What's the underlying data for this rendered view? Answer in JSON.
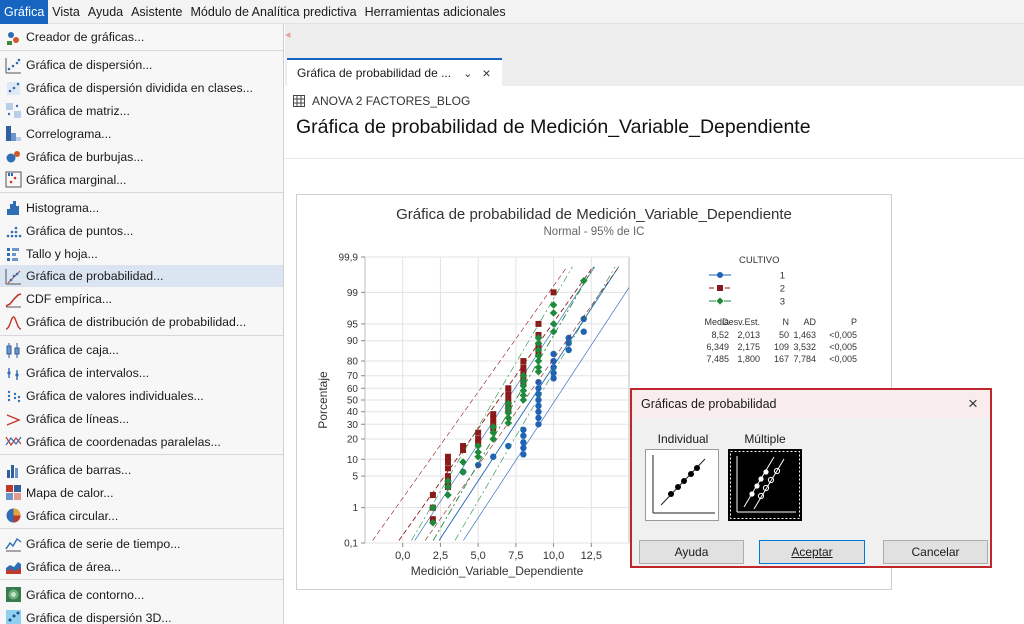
{
  "menubar": {
    "items": [
      "Gráfica",
      "Vista",
      "Ayuda",
      "Asistente",
      "Módulo de Analítica predictiva",
      "Herramientas adicionales"
    ]
  },
  "menu": {
    "groups": [
      [
        "Creador de gráficas..."
      ],
      [
        "Gráfica de dispersión...",
        "Gráfica de dispersión dividida en clases...",
        "Gráfica de matriz...",
        "Correlograma...",
        "Gráfica de burbujas...",
        "Gráfica marginal..."
      ],
      [
        "Histograma...",
        "Gráfica de puntos...",
        "Tallo y hoja...",
        "Gráfica de probabilidad...",
        "CDF empírica...",
        "Gráfica de distribución de probabilidad..."
      ],
      [
        "Gráfica de caja...",
        "Gráfica de intervalos...",
        "Gráfica de valores individuales...",
        "Gráfica de líneas...",
        "Gráfica de coordenadas paralelas..."
      ],
      [
        "Gráfica de barras...",
        "Mapa de calor...",
        "Gráfica circular..."
      ],
      [
        "Gráfica de serie de tiempo...",
        "Gráfica de área..."
      ],
      [
        "Gráfica de contorno...",
        "Gráfica de dispersión 3D..."
      ]
    ],
    "highlighted": "Gráfica de probabilidad...",
    "icons": [
      "chart-builder-icon",
      "scatterplot-icon",
      "binned-scatterplot-icon",
      "matrix-plot-icon",
      "correlogram-icon",
      "bubble-plot-icon",
      "marginal-plot-icon",
      "histogram-icon",
      "dotplot-icon",
      "stem-and-leaf-icon",
      "probability-plot-icon",
      "empirical-cdf-icon",
      "distribution-plot-icon",
      "boxplot-icon",
      "interval-plot-icon",
      "individual-value-plot-icon",
      "line-plot-icon",
      "parallel-coordinates-icon",
      "bar-chart-icon",
      "heatmap-icon",
      "pie-chart-icon",
      "time-series-icon",
      "area-graph-icon",
      "contour-plot-icon",
      "3d-scatterplot-icon"
    ]
  },
  "tab": {
    "label": "Gráfica de probabilidad de ...",
    "chevron": "⌄",
    "close": "×"
  },
  "worksheet": {
    "name": "ANOVA 2 FACTORES_BLOG",
    "icon": "table-grid-icon"
  },
  "page_title": "Gráfica de probabilidad de Medición_Variable_Dependiente",
  "chart_data": {
    "type": "scatter",
    "title": "Gráfica de probabilidad de Medición_Variable_Dependiente",
    "subtitle": "Normal - 95% de IC",
    "xlabel": "Medición_Variable_Dependiente",
    "ylabel": "Porcentaje",
    "xlim": [
      -2.5,
      15
    ],
    "x_ticks": [
      "0,0",
      "2,5",
      "5,0",
      "7,5",
      "10,0",
      "12,5"
    ],
    "x_tick_values": [
      0,
      2.5,
      5,
      7.5,
      10,
      12.5
    ],
    "y_scale": "normal-probability",
    "y_ticks": [
      "0,1",
      "1",
      "5",
      "10",
      "20",
      "30",
      "40",
      "50",
      "60",
      "70",
      "80",
      "90",
      "95",
      "99",
      "99,9"
    ],
    "y_tick_values": [
      0.1,
      1,
      5,
      10,
      20,
      30,
      40,
      50,
      60,
      70,
      80,
      90,
      95,
      99,
      99.9
    ],
    "grid": true,
    "legend_title": "CULTIVO",
    "legend_position": "right",
    "series": [
      {
        "name": "1",
        "color": "#1f63b5",
        "marker": "circle",
        "line": "solid",
        "fit_mean": 8.52,
        "fit_sd": 2.013,
        "x": [
          8,
          8,
          8,
          8,
          8,
          9,
          9,
          9,
          9,
          9,
          9,
          9,
          9,
          10,
          10,
          10,
          10,
          10,
          11,
          11,
          11,
          12,
          12,
          4,
          5,
          6,
          7
        ],
        "y": [
          12,
          15,
          18,
          22,
          26,
          30,
          35,
          40,
          45,
          50,
          55,
          60,
          65,
          68,
          72,
          76,
          80,
          84,
          86,
          89,
          91,
          93,
          96,
          6,
          8,
          11,
          16
        ]
      },
      {
        "name": "2",
        "color": "#8b1a1a",
        "marker": "square",
        "line": "dash",
        "fit_mean": 6.349,
        "fit_sd": 2.175,
        "x": [
          2,
          2,
          2,
          3,
          3,
          3,
          3,
          3,
          3,
          4,
          4,
          5,
          5,
          5,
          6,
          6,
          6,
          6,
          7,
          7,
          7,
          7,
          7,
          8,
          8,
          8,
          8,
          8,
          9,
          9,
          9,
          9,
          10
        ],
        "y": [
          0.5,
          1,
          2,
          3,
          4,
          5,
          7,
          9,
          11,
          14,
          16,
          18,
          20,
          24,
          27,
          30,
          34,
          38,
          42,
          46,
          50,
          55,
          60,
          64,
          68,
          72,
          76,
          80,
          84,
          88,
          92,
          95,
          99
        ]
      },
      {
        "name": "3",
        "color": "#1e8a3c",
        "marker": "diamond",
        "line": "dashdot",
        "fit_mean": 7.485,
        "fit_sd": 1.8,
        "x": [
          2,
          2,
          3,
          3,
          3,
          4,
          4,
          5,
          5,
          5,
          6,
          6,
          6,
          7,
          7,
          7,
          7,
          7,
          8,
          8,
          8,
          8,
          8,
          8,
          9,
          9,
          9,
          9,
          9,
          9,
          9,
          10,
          10,
          10,
          10,
          12
        ],
        "y": [
          0.4,
          1,
          2,
          3,
          4,
          6,
          9,
          11,
          13,
          16,
          20,
          24,
          28,
          31,
          35,
          39,
          43,
          47,
          50,
          54,
          58,
          62,
          66,
          70,
          73,
          76,
          80,
          83,
          86,
          89,
          91,
          93,
          95,
          97,
          98,
          99.5
        ]
      }
    ],
    "stats_table": {
      "headers": [
        "Media",
        "Desv.Est.",
        "N",
        "AD",
        "P"
      ],
      "rows": [
        [
          "8,52",
          "2,013",
          "50",
          "1,463",
          "<0,005"
        ],
        [
          "6,349",
          "2,175",
          "109",
          "3,532",
          "<0,005"
        ],
        [
          "7,485",
          "1,800",
          "167",
          "7,784",
          "<0,005"
        ]
      ]
    },
    "legend_labels": [
      "1",
      "2",
      "3"
    ]
  },
  "dialog": {
    "title": "Gráficas de probabilidad",
    "close": "×",
    "options": [
      "Individual",
      "Múltiple"
    ],
    "selected": "Múltiple",
    "buttons": [
      "Ayuda",
      "Aceptar",
      "Cancelar"
    ]
  },
  "colors": {
    "accent": "#1565c0",
    "dialog_border": "#c0272d",
    "menu_highlight": "#dbe5f1"
  }
}
